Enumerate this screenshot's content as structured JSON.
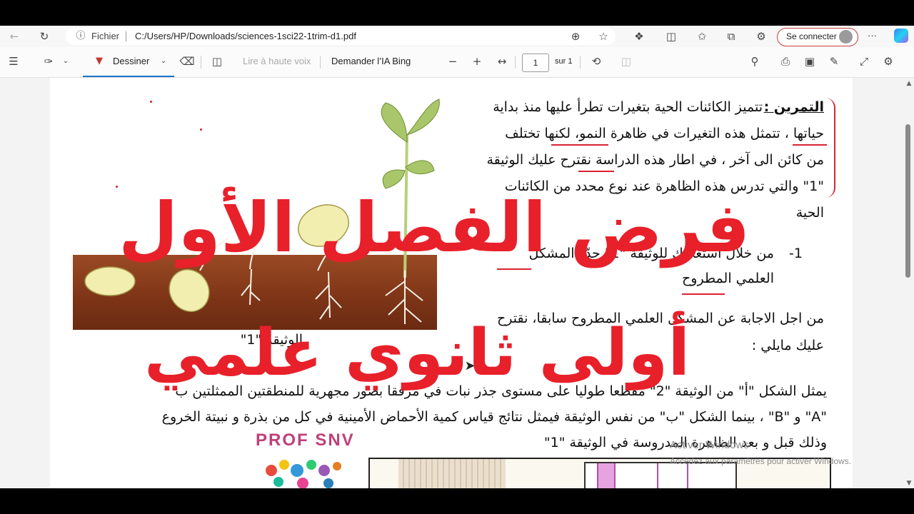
{
  "browser": {
    "file_label": "Fichier",
    "url": "C:/Users/HP/Downloads/sciences-1sci22-1trim-d1.pdf",
    "signin_label": "Se connecter",
    "more_label": "···"
  },
  "pdf_toolbar": {
    "draw_label": "Dessiner",
    "read_aloud_label": "Lire à haute voix",
    "ask_bing_label": "Demander l’IA Bing",
    "page_number": "1",
    "page_total": "sur 1"
  },
  "document": {
    "exercise_title": "التمرين :",
    "intro_lines": [
      "تتميز الكائنات الحية بتغيرات تطرأ عليها منذ بداية",
      "حياتها ، تتمثل هذه التغيرات في ظاهرة النمو، لكنها تختلف",
      "من كائن الى آخر ، في اطار هذه الدراسة نقترح عليك الوثيقة",
      "\"1\" والتي تدرس هذه الظاهرة عند نوع محدد من الكائنات",
      "الحية"
    ],
    "question1_number": "1-",
    "question1_lines": [
      "من خلال استغلالك للوثيقة \"1\" حدّد المشكل",
      "العلمي المطروح"
    ],
    "answer_lines": [
      "من اجل الاجابة عن المشكل العلمي المطروح سابقا، نقترح",
      "عليك مايلي :"
    ],
    "doc_label": "الوثيقة \"1\"",
    "paragraph_lines": [
      "يمثل الشكل \"أ\" من الوثيقة \"2\" مقطعا طوليا على مستوى جذر نبات في مرفقا بصور مجهرية للمنطقتين الممثلتين ب",
      "\"A\" و \"B\" ،  بينما الشكل \"ب\" من نفس الوثيقة فيمثل نتائج قياس كمية الأحماض الأمينية في كل من بذرة و نبيتة الخروع",
      "وذلك قبل و بعد الظاهرة المدروسة في الوثيقة \"1\""
    ],
    "prof_logo": "PROF SNV"
  },
  "overlay": {
    "title_line1": "فرض الفصل الأول",
    "title_line2": "أولى ثانوي علمي",
    "color": "#e8202a"
  },
  "windows_activation": {
    "title": "Activer Windows",
    "subtitle": "Accédez aux paramètres pour activer Windows."
  }
}
